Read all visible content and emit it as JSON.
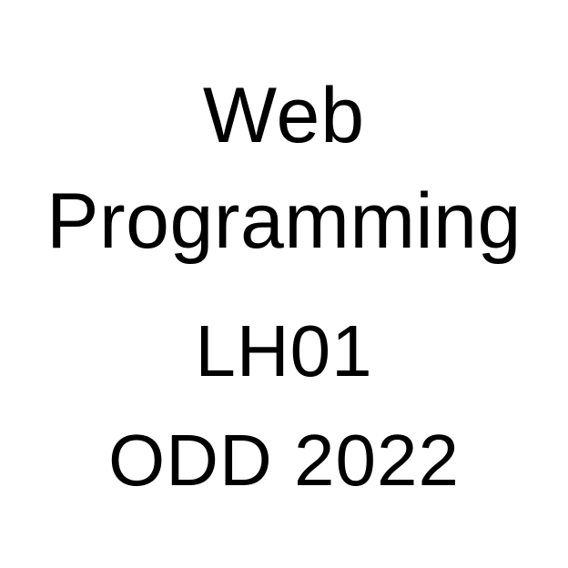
{
  "title_card": {
    "line1": "Web",
    "line2": "Programming",
    "line3": "LH01",
    "line4": "ODD 2022"
  },
  "colors": {
    "background": "#ffffff",
    "text": "#000000"
  }
}
